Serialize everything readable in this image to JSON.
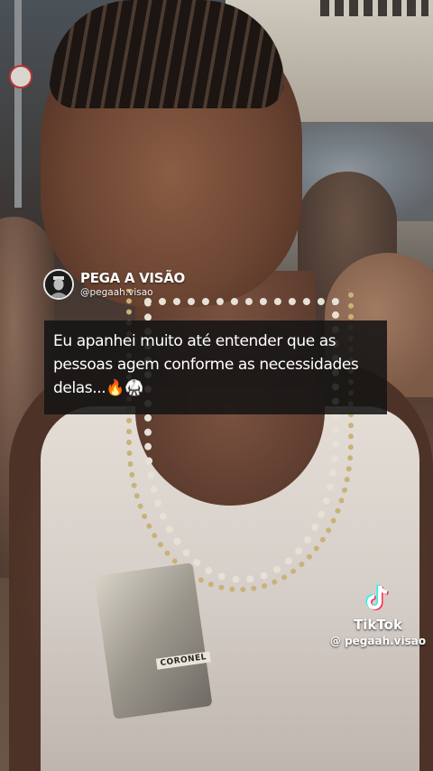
{
  "profile": {
    "name": "PEGA A VISÃO",
    "handle": "@pegaah.visao",
    "avatar_icon": "avatar-portrait-icon"
  },
  "caption": {
    "text": "Eu apanhei muito até entender que as pessoas agem conforme as necessidades delas...🔥🥋"
  },
  "photo": {
    "pendant_text": "CORONEL"
  },
  "watermark": {
    "logo_icon": "tiktok-logo-icon",
    "brand": "TikTok",
    "handle": "@ pegaah.visao"
  }
}
